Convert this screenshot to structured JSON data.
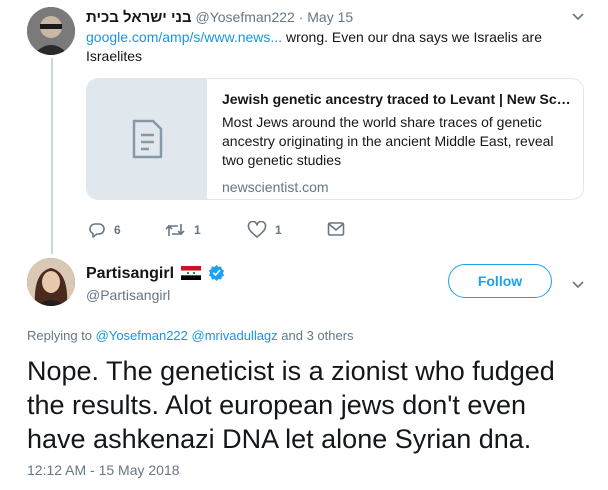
{
  "reply_tweet": {
    "display_name": "בני ישראל בכית",
    "handle": "@Yosefman222",
    "separator": "·",
    "date": "May 15",
    "link_text": "google.com/amp/s/www.news...",
    "text_after_link": " wrong. Even our dna says we Israelis are",
    "text_line2": "Israelites",
    "card": {
      "title": "Jewish genetic ancestry traced to Levant | New Sci...",
      "description": "Most Jews around the world share traces of genetic ancestry originating in the ancient Middle East, reveal two genetic studies",
      "domain": "newscientist.com"
    },
    "actions": {
      "replies": "6",
      "retweets": "1",
      "likes": "1"
    }
  },
  "main_tweet": {
    "display_name": "Partisangirl",
    "handle": "@Partisangirl",
    "follow_label": "Follow",
    "replying_prefix": "Replying to ",
    "replying_users": "@Yosefman222 @mrivadullagz",
    "replying_suffix": " and 3 others",
    "text": "Nope. The geneticist is a zionist who fudged the results. Alot european jews don't even have ashkenazi DNA let alone Syrian dna.",
    "timestamp": "12:12 AM - 15 May 2018"
  },
  "colors": {
    "accent": "#1da1f2",
    "link": "#1b95e0",
    "muted": "#657786",
    "border": "#e1e8ed"
  }
}
